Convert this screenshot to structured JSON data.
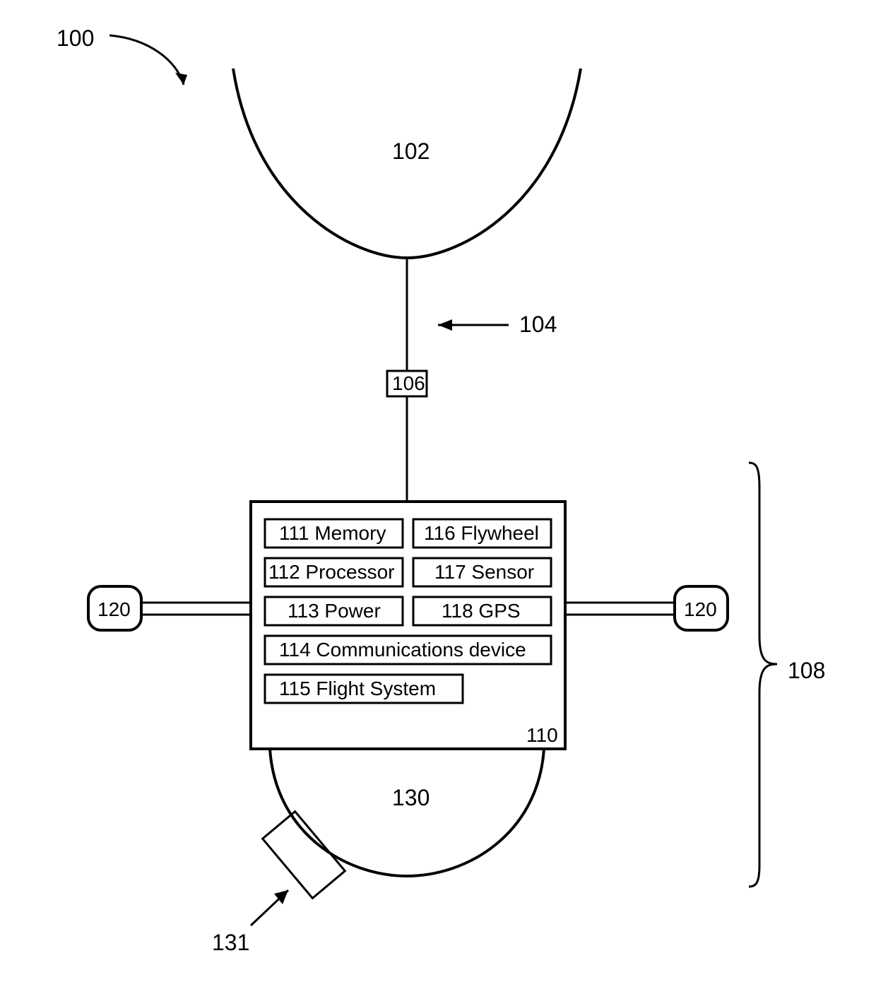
{
  "refs": {
    "r100": "100",
    "r102": "102",
    "r104": "104",
    "r106": "106",
    "r108": "108",
    "r110": "110",
    "r111": "111 Memory",
    "r112": "112 Processor",
    "r113": "113 Power",
    "r114": "114 Communications device",
    "r115": "115 Flight System",
    "r116": "116 Flywheel",
    "r117": "117 Sensor",
    "r118": "118 GPS",
    "r120": "120",
    "r130": "130",
    "r131": "131"
  }
}
